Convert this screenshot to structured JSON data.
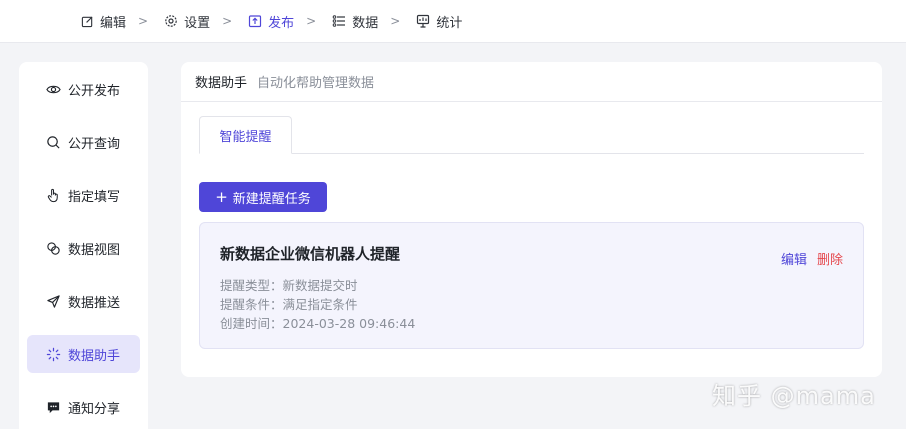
{
  "topnav": {
    "steps": [
      {
        "label": "编辑",
        "icon": "edit-icon"
      },
      {
        "label": "设置",
        "icon": "gear-icon"
      },
      {
        "label": "发布",
        "icon": "publish-icon"
      },
      {
        "label": "数据",
        "icon": "data-icon"
      },
      {
        "label": "统计",
        "icon": "stats-icon"
      }
    ],
    "separator": ">"
  },
  "sidebar": {
    "items": [
      {
        "label": "公开发布",
        "icon": "eye-icon"
      },
      {
        "label": "公开查询",
        "icon": "search-icon"
      },
      {
        "label": "指定填写",
        "icon": "hand-pointer-icon"
      },
      {
        "label": "数据视图",
        "icon": "view-icon"
      },
      {
        "label": "数据推送",
        "icon": "send-icon"
      },
      {
        "label": "数据助手",
        "icon": "sparkle-icon"
      },
      {
        "label": "通知分享",
        "icon": "message-icon"
      }
    ]
  },
  "main": {
    "title": "数据助手",
    "subtitle": "自动化帮助管理数据",
    "tab": "智能提醒",
    "new_button": "新建提醒任务",
    "new_button_icon": "+",
    "card": {
      "title": "新数据企业微信机器人提醒",
      "type_label": "提醒类型：",
      "type_value": "新数据提交时",
      "cond_label": "提醒条件：",
      "cond_value": "满足指定条件",
      "time_label": "创建时间：",
      "time_value": "2024-03-28 09:46:44",
      "edit": "编辑",
      "delete": "删除"
    }
  },
  "watermark": "知乎 @mama",
  "colors": {
    "accent": "#4f46d8",
    "danger": "#e5484d",
    "active_bg": "#e6e5fb",
    "card_bg": "#f4f4fd"
  }
}
